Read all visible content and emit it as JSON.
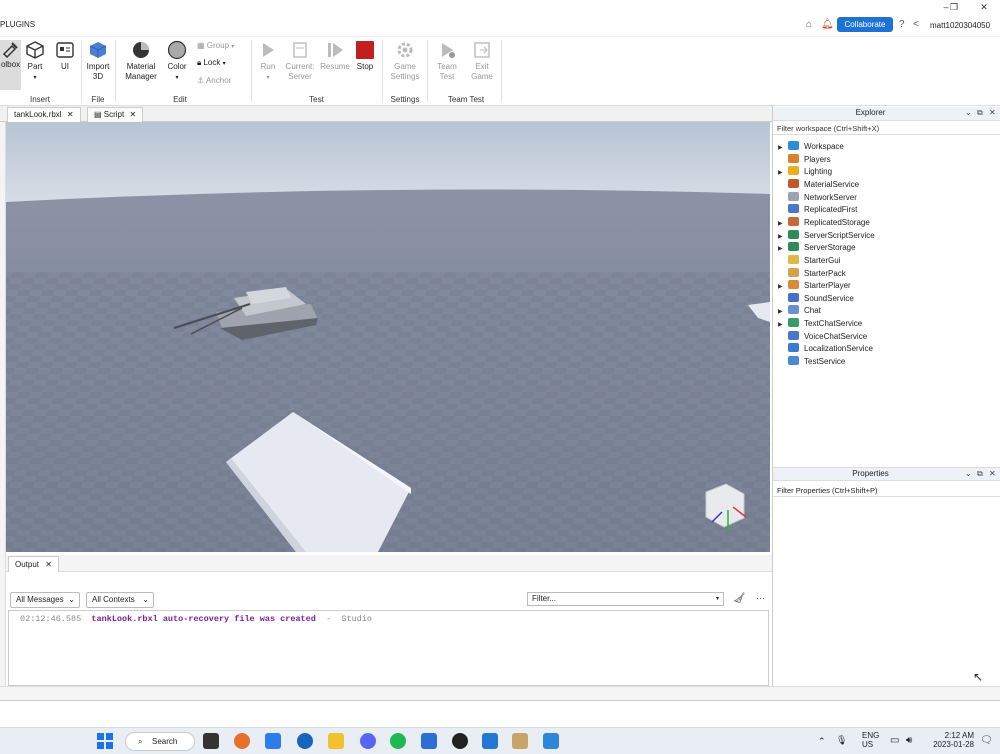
{
  "menubar": {
    "plugins": "PLUGINS",
    "collaborate": "Collaborate",
    "username": "matt1020304050"
  },
  "ribbon": {
    "insert": {
      "toolbox": "olbox",
      "part": "Part",
      "ui": "UI",
      "group_label": "Insert"
    },
    "file": {
      "import3d": "Import\n3D",
      "import_a": "Import",
      "import_b": "3D",
      "group_label": "File"
    },
    "edit": {
      "material_a": "Material",
      "material_b": "Manager",
      "color": "Color",
      "group": "Group",
      "lock": "Lock",
      "anchor": "Anchor",
      "group_label": "Edit"
    },
    "test": {
      "run": "Run",
      "current_a": "Current:",
      "current_b": "Server",
      "resume": "Resume",
      "stop": "Stop",
      "group_label": "Test"
    },
    "settings": {
      "game_a": "Game",
      "game_b": "Settings",
      "group_label": "Settings"
    },
    "teamtest": {
      "team_a": "Team",
      "team_b": "Test",
      "exit_a": "Exit",
      "exit_b": "Game",
      "group_label": "Team Test"
    }
  },
  "tabs": [
    {
      "label": "tankLook.rbxl"
    },
    {
      "label": "Script"
    }
  ],
  "output": {
    "tab": "Output",
    "messages_filter": "All Messages",
    "contexts_filter": "All Contexts",
    "filter_placeholder": "Filter...",
    "log": [
      {
        "time": "02:12:46.585",
        "message": "tankLook.rbxl auto-recovery file was created",
        "sep": "-",
        "source": "Studio"
      }
    ]
  },
  "explorer": {
    "title": "Explorer",
    "filter": "Filter workspace (Ctrl+Shift+X)",
    "items": [
      {
        "label": "Workspace",
        "expandable": true,
        "color": "#2b8fd6"
      },
      {
        "label": "Players",
        "expandable": false,
        "color": "#d9822b"
      },
      {
        "label": "Lighting",
        "expandable": true,
        "color": "#e8b020"
      },
      {
        "label": "MaterialService",
        "expandable": false,
        "color": "#c05a2a"
      },
      {
        "label": "NetworkServer",
        "expandable": false,
        "color": "#9aa4b0"
      },
      {
        "label": "ReplicatedFirst",
        "expandable": false,
        "color": "#4a78c8"
      },
      {
        "label": "ReplicatedStorage",
        "expandable": true,
        "color": "#c76a3a"
      },
      {
        "label": "ServerScriptService",
        "expandable": true,
        "color": "#2e8b57"
      },
      {
        "label": "ServerStorage",
        "expandable": true,
        "color": "#2e8b57"
      },
      {
        "label": "StarterGui",
        "expandable": false,
        "color": "#e0b84a"
      },
      {
        "label": "StarterPack",
        "expandable": false,
        "color": "#d4a24a"
      },
      {
        "label": "StarterPlayer",
        "expandable": true,
        "color": "#d98a3a"
      },
      {
        "label": "SoundService",
        "expandable": false,
        "color": "#4a6fc8"
      },
      {
        "label": "Chat",
        "expandable": true,
        "color": "#6a8fd0"
      },
      {
        "label": "TextChatService",
        "expandable": true,
        "color": "#3a9a6a"
      },
      {
        "label": "VoiceChatService",
        "expandable": false,
        "color": "#4a78c8"
      },
      {
        "label": "LocalizationService",
        "expandable": false,
        "color": "#3a7ad0"
      },
      {
        "label": "TestService",
        "expandable": false,
        "color": "#4a8ad0"
      }
    ]
  },
  "properties": {
    "title": "Properties",
    "filter": "Filter Properties (Ctrl+Shift+P)"
  },
  "taskbar": {
    "search": "Search",
    "lang_a": "ENG",
    "lang_b": "US",
    "time": "2:12 AM",
    "date": "2023-01-28"
  }
}
